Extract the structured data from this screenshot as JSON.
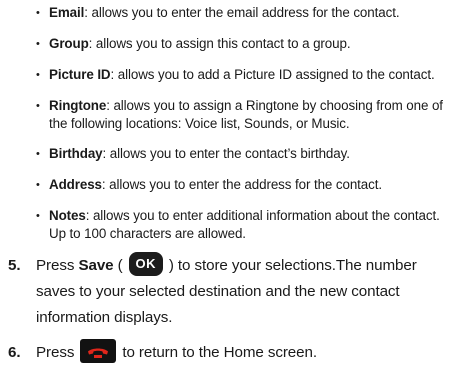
{
  "bullets": [
    {
      "term": "Email",
      "text": ": allows you to enter the email address for the contact."
    },
    {
      "term": "Group",
      "text": ": allows you to assign this contact to a group."
    },
    {
      "term": "Picture ID",
      "text": ": allows you to add a Picture ID assigned to the contact."
    },
    {
      "term": "Ringtone",
      "text": ": allows you to assign a Ringtone by choosing from one of",
      "text2": "the following locations: Voice list, Sounds, or Music."
    },
    {
      "term": "Birthday",
      "text": ": allows you to enter the contact’s birthday."
    },
    {
      "term": "Address",
      "text": ": allows you to enter the address for the contact."
    },
    {
      "term": "Notes",
      "text": ": allows you to enter additional information about the contact.",
      "text2": "Up to 100 characters are allowed."
    }
  ],
  "bullet_symbol": "•",
  "step5": {
    "number": "5.",
    "lead": "Press ",
    "action": "Save",
    "open_paren": " ( ",
    "key_label": "OK",
    "close_paren": " ) to store your selections.The number",
    "line2": "saves to your selected destination and the new contact",
    "line3": "information displays."
  },
  "step6": {
    "number": "6.",
    "lead": "Press",
    "tail": "to return to the Home screen."
  },
  "icons": {
    "ok_key": "ok-key-icon",
    "end_key": "end-call-key-icon",
    "end_key_color": "#e0261b"
  }
}
